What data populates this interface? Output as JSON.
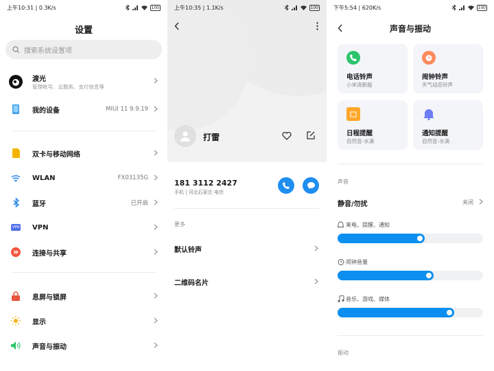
{
  "p1": {
    "status": {
      "time": "上午10:31 | 0.3K/s",
      "battery": "100"
    },
    "title": "设置",
    "search": {
      "placeholder": "搜索系统设置项"
    },
    "account": {
      "name": "渡光",
      "sub": "管理帐号、云服务、支付信息等"
    },
    "device": {
      "label": "我的设备",
      "value": "MIUI 11 9.9.19"
    },
    "net": [
      {
        "label": "双卡与移动网络",
        "value": ""
      },
      {
        "label": "WLAN",
        "value": "FX03135G"
      },
      {
        "label": "蓝牙",
        "value": "已开启"
      },
      {
        "label": "VPN",
        "value": ""
      },
      {
        "label": "连接与共享",
        "value": ""
      }
    ],
    "system": [
      {
        "label": "息屏与锁屏"
      },
      {
        "label": "显示"
      },
      {
        "label": "声音与振动"
      }
    ],
    "icons": [
      "avatar-icon",
      "phone-device-icon",
      "sim-icon",
      "wifi-icon",
      "bluetooth-icon",
      "vpn-icon",
      "share-icon",
      "lock-icon",
      "brightness-icon",
      "sound-icon"
    ],
    "vpn_badge": "VPN"
  },
  "p2": {
    "status": {
      "time": "上午10:35 | 1.1K/s",
      "battery": "100"
    },
    "name": "打雷",
    "phone": "181 3112 2427",
    "phone_sub": "手机 | 河北石家庄 电信",
    "more_label": "更多",
    "items": [
      "默认铃声",
      "二维码名片"
    ],
    "accent": "#1e8ef0"
  },
  "p3": {
    "status": {
      "time": "下午5:54 | 620K/s",
      "battery": "100"
    },
    "title": "声音与振动",
    "cards": [
      {
        "title": "电话铃声",
        "sub": "小米清新版",
        "color": "#2cc46b"
      },
      {
        "title": "闹钟铃声",
        "sub": "天气动态铃声",
        "color": "#ff8a5c"
      },
      {
        "title": "日程提醒",
        "sub": "自然音-水滴",
        "color": "#ffa72b"
      },
      {
        "title": "通知提醒",
        "sub": "自然音-水滴",
        "color": "#6b7cf7"
      }
    ],
    "sound_section": "声音",
    "mute": {
      "label": "静音/勿扰",
      "value": "关闭"
    },
    "volumes": [
      {
        "label": "来电、提醒、通知",
        "level": 0.6
      },
      {
        "label": "闹钟音量",
        "level": 0.66
      },
      {
        "label": "音乐、游戏、媒体",
        "level": 0.8
      }
    ],
    "vibrate_section": "振动",
    "accent": "#0d8ff0"
  }
}
